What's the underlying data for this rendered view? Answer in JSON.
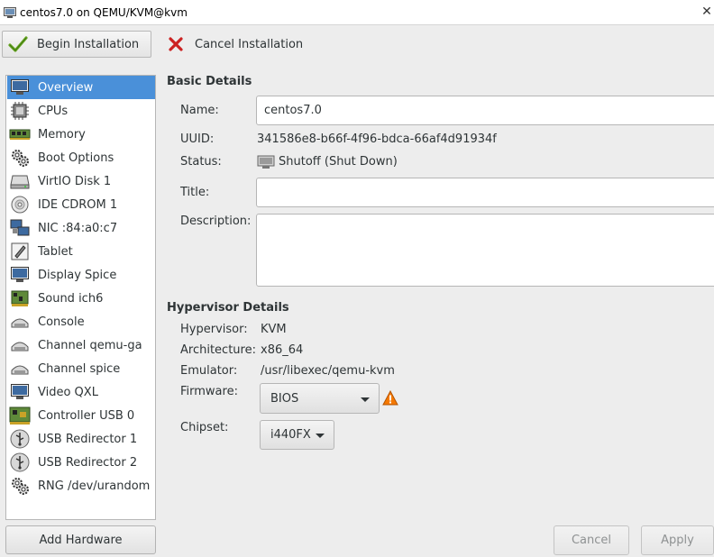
{
  "window": {
    "title": "centos7.0 on QEMU/KVM@kvm"
  },
  "toolbar": {
    "begin_label": "Begin Installation",
    "cancel_label": "Cancel Installation"
  },
  "sidebar": {
    "items": [
      {
        "label": "Overview",
        "icon": "monitor-icon"
      },
      {
        "label": "CPUs",
        "icon": "cpu-icon"
      },
      {
        "label": "Memory",
        "icon": "memory-icon"
      },
      {
        "label": "Boot Options",
        "icon": "gears-icon"
      },
      {
        "label": "VirtIO Disk 1",
        "icon": "disk-icon"
      },
      {
        "label": "IDE CDROM 1",
        "icon": "cdrom-icon"
      },
      {
        "label": "NIC :84:a0:c7",
        "icon": "network-icon"
      },
      {
        "label": "Tablet",
        "icon": "tablet-icon"
      },
      {
        "label": "Display Spice",
        "icon": "display-icon"
      },
      {
        "label": "Sound ich6",
        "icon": "sound-card-icon"
      },
      {
        "label": "Console",
        "icon": "serial-icon"
      },
      {
        "label": "Channel qemu-ga",
        "icon": "serial-icon"
      },
      {
        "label": "Channel spice",
        "icon": "serial-icon"
      },
      {
        "label": "Video QXL",
        "icon": "display-icon"
      },
      {
        "label": "Controller USB 0",
        "icon": "controller-icon"
      },
      {
        "label": "USB Redirector 1",
        "icon": "usb-icon"
      },
      {
        "label": "USB Redirector 2",
        "icon": "usb-icon"
      },
      {
        "label": "RNG /dev/urandom",
        "icon": "gears-icon"
      }
    ],
    "selected_index": 0,
    "add_hardware_label": "Add Hardware"
  },
  "basic": {
    "heading": "Basic Details",
    "name_label": "Name:",
    "name_value": "centos7.0",
    "uuid_label": "UUID:",
    "uuid_value": "341586e8-b66f-4f96-bdca-66af4d91934f",
    "status_label": "Status:",
    "status_value": "Shutoff (Shut Down)",
    "title_label": "Title:",
    "title_value": "",
    "description_label": "Description:",
    "description_value": ""
  },
  "hypervisor": {
    "heading": "Hypervisor Details",
    "hypervisor_label": "Hypervisor:",
    "hypervisor_value": "KVM",
    "arch_label": "Architecture:",
    "arch_value": "x86_64",
    "emulator_label": "Emulator:",
    "emulator_value": "/usr/libexec/qemu-kvm",
    "firmware_label": "Firmware:",
    "firmware_value": "BIOS",
    "chipset_label": "Chipset:",
    "chipset_value": "i440FX"
  },
  "footer": {
    "cancel_label": "Cancel",
    "apply_label": "Apply"
  },
  "colors": {
    "selection": "#4a90d9",
    "warning": "#f57900",
    "cancel_red": "#cc0000",
    "check_green": "#4e9a06"
  }
}
